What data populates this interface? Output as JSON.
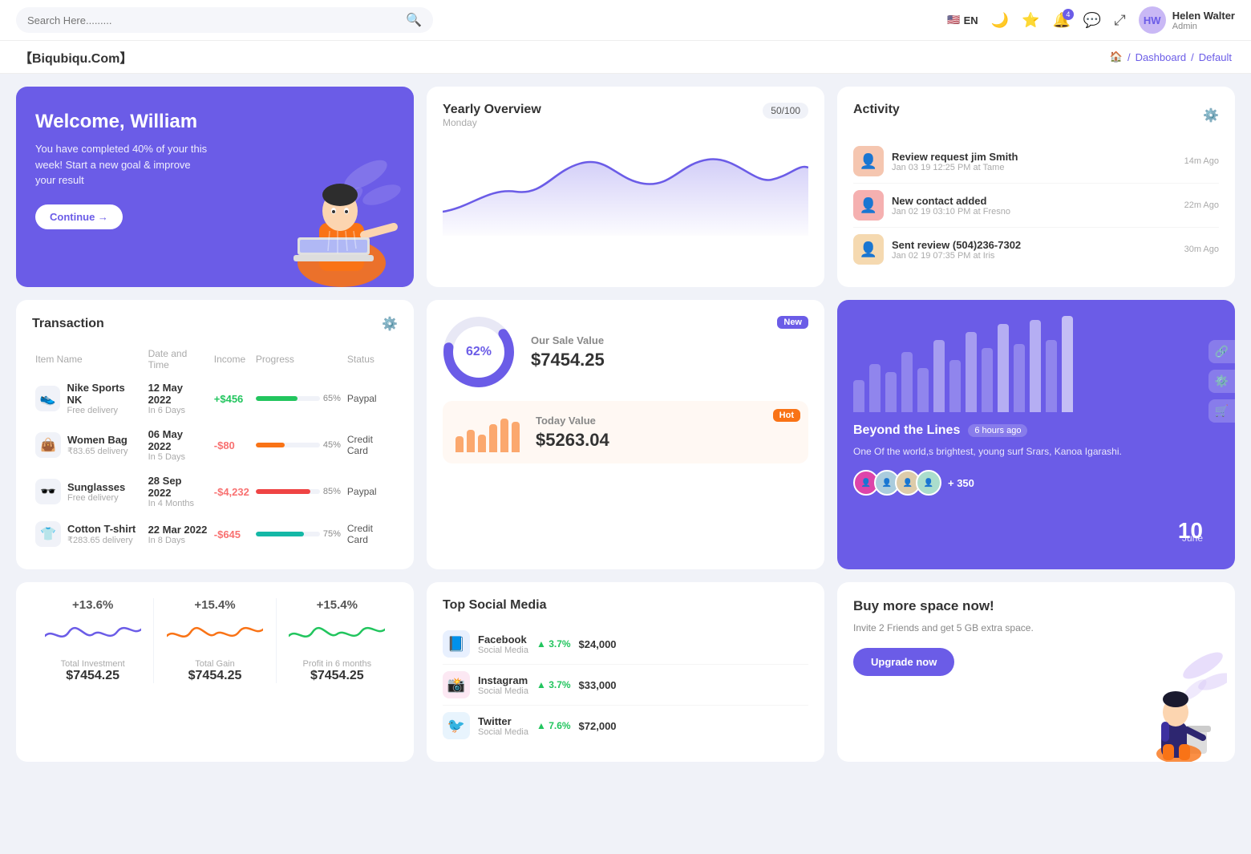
{
  "topnav": {
    "search_placeholder": "Search Here.........",
    "language": "EN",
    "notification_count": "4",
    "username": "Helen Walter",
    "user_role": "Admin"
  },
  "breadcrumb": {
    "brand": "【Biqubiqu.Com】",
    "home": "Home",
    "dashboard": "Dashboard",
    "current": "Default"
  },
  "welcome": {
    "title": "Welcome, William",
    "subtitle": "You have completed 40% of your this week! Start a new goal & improve your result",
    "button": "Continue →"
  },
  "yearly": {
    "title": "Yearly Overview",
    "subtitle": "Monday",
    "progress": "50/100"
  },
  "activity": {
    "title": "Activity",
    "items": [
      {
        "title": "Review request jim Smith",
        "sub": "Jan 03 19 12:25 PM at Tame",
        "time": "14m Ago",
        "color": "#f5c6b0"
      },
      {
        "title": "New contact added",
        "sub": "Jan 02 19 03:10 PM at Fresno",
        "time": "22m Ago",
        "color": "#f5b0b0"
      },
      {
        "title": "Sent review (504)236-7302",
        "sub": "Jan 02 19 07:35 PM at Iris",
        "time": "30m Ago",
        "color": "#f5d9b0"
      }
    ]
  },
  "transaction": {
    "title": "Transaction",
    "headers": [
      "Item Name",
      "Date and Time",
      "Income",
      "Progress",
      "Status"
    ],
    "rows": [
      {
        "icon": "👟",
        "name": "Nike Sports NK",
        "sub": "Free delivery",
        "date": "12 May 2022",
        "period": "In 6 Days",
        "income": "+$456",
        "income_type": "pos",
        "progress": 65,
        "progress_color": "green",
        "status": "Paypal"
      },
      {
        "icon": "👜",
        "name": "Women Bag",
        "sub": "₹83.65 delivery",
        "date": "06 May 2022",
        "period": "In 5 Days",
        "income": "-$80",
        "income_type": "neg",
        "progress": 45,
        "progress_color": "orange",
        "status": "Credit Card"
      },
      {
        "icon": "🕶️",
        "name": "Sunglasses",
        "sub": "Free delivery",
        "date": "28 Sep 2022",
        "period": "In 4 Months",
        "income": "-$4,232",
        "income_type": "neg",
        "progress": 85,
        "progress_color": "red",
        "status": "Paypal"
      },
      {
        "icon": "👕",
        "name": "Cotton T-shirt",
        "sub": "₹283.65 delivery",
        "date": "22 Mar 2022",
        "period": "In 8 Days",
        "income": "-$645",
        "income_type": "neg",
        "progress": 75,
        "progress_color": "teal",
        "status": "Credit Card"
      }
    ]
  },
  "salecard": {
    "new_badge": "New",
    "donut_pct": "62%",
    "sale_label": "Our Sale Value",
    "sale_value": "$7454.25",
    "hot_badge": "Hot",
    "today_label": "Today Value",
    "today_value": "$5263.04"
  },
  "beyond": {
    "title": "Beyond the Lines",
    "time_ago": "6 hours ago",
    "description": "One Of the world,s brightest, young surf Srars, Kanoa Igarashi.",
    "plus": "+ 350",
    "date_day": "10",
    "date_month": "June"
  },
  "stats": [
    {
      "pct": "+13.6%",
      "label": "Total Investment",
      "value": "$7454.25",
      "wave_color": "#6b5ce7"
    },
    {
      "pct": "+15.4%",
      "label": "Total Gain",
      "value": "$7454.25",
      "wave_color": "#f97316"
    },
    {
      "pct": "+15.4%",
      "label": "Profit in 6 months",
      "value": "$7454.25",
      "wave_color": "#22c55e"
    }
  ],
  "social": {
    "title": "Top Social Media",
    "rows": [
      {
        "icon": "📘",
        "name": "Facebook",
        "sub": "Social Media",
        "growth": "3.7%",
        "value": "$24,000",
        "icon_bg": "#e8f0fe"
      },
      {
        "icon": "📸",
        "name": "Instagram",
        "sub": "Social Media",
        "growth": "3.7%",
        "value": "$33,000",
        "icon_bg": "#fce8f3"
      },
      {
        "icon": "🐦",
        "name": "Twitter",
        "sub": "Social Media",
        "growth": "7.6%",
        "value": "$72,000",
        "icon_bg": "#e8f4fd"
      }
    ]
  },
  "buyspace": {
    "title": "Buy more space now!",
    "description": "Invite 2 Friends and get 5 GB extra space.",
    "button": "Upgrade now"
  }
}
